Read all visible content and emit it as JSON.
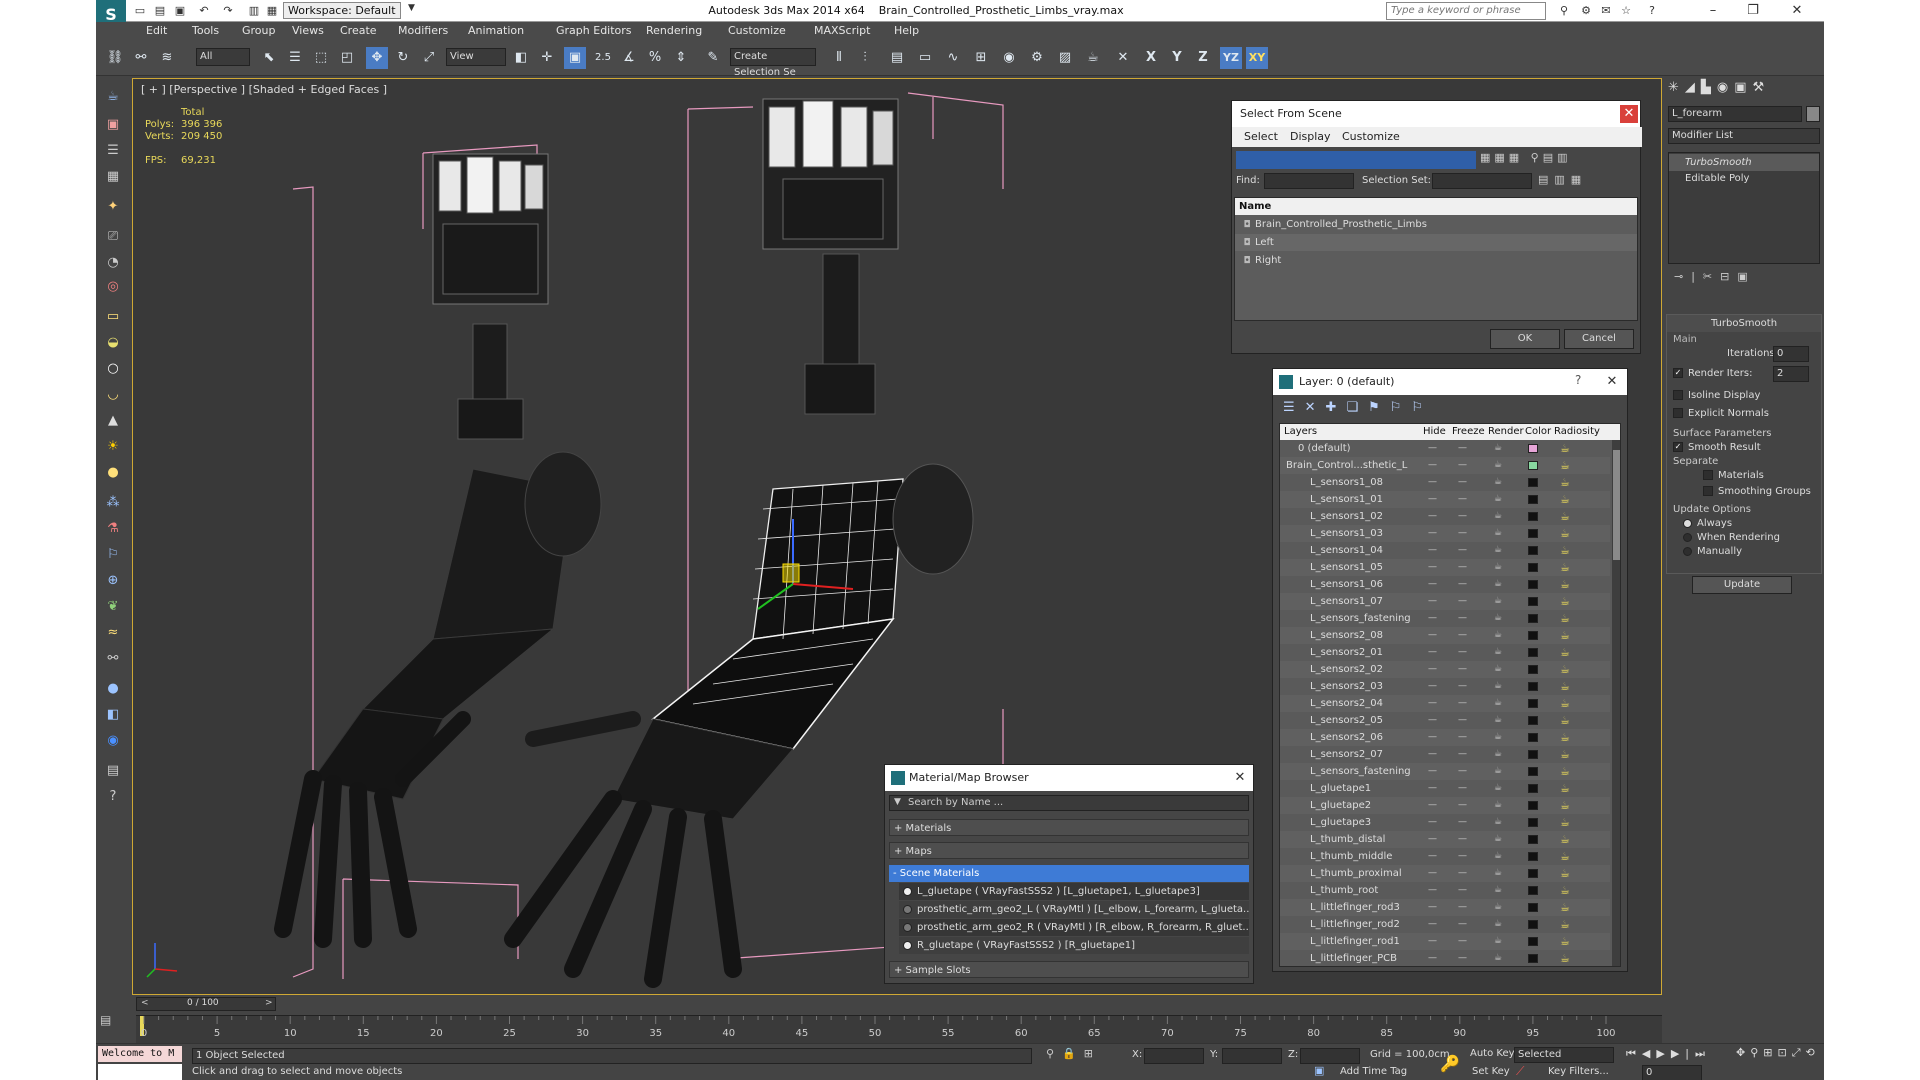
{
  "title_bar": {
    "workspace": "Workspace: Default",
    "app": "Autodesk 3ds Max  2014 x64",
    "file": "Brain_Controlled_Prosthetic_Limbs_vray.max",
    "search_placeholder": "Type a keyword or phrase"
  },
  "menu": [
    "Edit",
    "Tools",
    "Group",
    "Views",
    "Create",
    "Modifiers",
    "Animation",
    "Graph Editors",
    "Rendering",
    "Customize",
    "MAXScript",
    "Help"
  ],
  "toolbar": {
    "filter": "All",
    "refcoord": "View",
    "snap_label": "2.5",
    "selection_set": "Create Selection Se",
    "axis_x": "X",
    "axis_y": "Y",
    "axis_z": "Z",
    "axis_yz": "YZ",
    "axis_xy": "XY"
  },
  "viewport": {
    "label": "[ + ] [Perspective ] [Shaded + Edged Faces ]",
    "stats": {
      "total_label": "Total",
      "polys_label": "Polys:",
      "polys": "396 396",
      "verts_label": "Verts:",
      "verts": "209 450",
      "fps_label": "FPS:",
      "fps": "69,231"
    }
  },
  "select_from_scene": {
    "title": "Select From Scene",
    "menus": [
      "Select",
      "Display",
      "Customize"
    ],
    "find_label": "Find:",
    "selection_set_label": "Selection Set:",
    "column": "Name",
    "items": [
      "Brain_Controlled_Prosthetic_Limbs",
      "Left",
      "Right"
    ],
    "ok": "OK",
    "cancel": "Cancel"
  },
  "layer_dialog": {
    "title": "Layer: 0 (default)",
    "help": "?",
    "columns": [
      "Layers",
      "Hide",
      "Freeze",
      "Render",
      "Color",
      "Radiosity"
    ],
    "rows": [
      {
        "name": "0 (default)",
        "indent": 1,
        "color": "#e7a6d8"
      },
      {
        "name": "Brain_Control...sthetic_L",
        "indent": 0,
        "color": "#88d8a0"
      },
      {
        "name": "L_sensors1_08",
        "indent": 2,
        "color": "#111111"
      },
      {
        "name": "L_sensors1_01",
        "indent": 2,
        "color": "#111111"
      },
      {
        "name": "L_sensors1_02",
        "indent": 2,
        "color": "#111111"
      },
      {
        "name": "L_sensors1_03",
        "indent": 2,
        "color": "#111111"
      },
      {
        "name": "L_sensors1_04",
        "indent": 2,
        "color": "#111111"
      },
      {
        "name": "L_sensors1_05",
        "indent": 2,
        "color": "#111111"
      },
      {
        "name": "L_sensors1_06",
        "indent": 2,
        "color": "#111111"
      },
      {
        "name": "L_sensors1_07",
        "indent": 2,
        "color": "#111111"
      },
      {
        "name": "L_sensors_fastening",
        "indent": 2,
        "color": "#111111"
      },
      {
        "name": "L_sensors2_08",
        "indent": 2,
        "color": "#111111"
      },
      {
        "name": "L_sensors2_01",
        "indent": 2,
        "color": "#111111"
      },
      {
        "name": "L_sensors2_02",
        "indent": 2,
        "color": "#111111"
      },
      {
        "name": "L_sensors2_03",
        "indent": 2,
        "color": "#111111"
      },
      {
        "name": "L_sensors2_04",
        "indent": 2,
        "color": "#111111"
      },
      {
        "name": "L_sensors2_05",
        "indent": 2,
        "color": "#111111"
      },
      {
        "name": "L_sensors2_06",
        "indent": 2,
        "color": "#111111"
      },
      {
        "name": "L_sensors2_07",
        "indent": 2,
        "color": "#111111"
      },
      {
        "name": "L_sensors_fastening",
        "indent": 2,
        "color": "#111111"
      },
      {
        "name": "L_gluetape1",
        "indent": 2,
        "color": "#111111"
      },
      {
        "name": "L_gluetape2",
        "indent": 2,
        "color": "#111111"
      },
      {
        "name": "L_gluetape3",
        "indent": 2,
        "color": "#111111"
      },
      {
        "name": "L_thumb_distal",
        "indent": 2,
        "color": "#111111"
      },
      {
        "name": "L_thumb_middle",
        "indent": 2,
        "color": "#111111"
      },
      {
        "name": "L_thumb_proximal",
        "indent": 2,
        "color": "#111111"
      },
      {
        "name": "L_thumb_root",
        "indent": 2,
        "color": "#111111"
      },
      {
        "name": "L_littlefinger_rod3",
        "indent": 2,
        "color": "#111111"
      },
      {
        "name": "L_littlefinger_rod2",
        "indent": 2,
        "color": "#111111"
      },
      {
        "name": "L_littlefinger_rod1",
        "indent": 2,
        "color": "#111111"
      },
      {
        "name": "L_littlefinger_PCB",
        "indent": 2,
        "color": "#111111"
      }
    ]
  },
  "material_browser": {
    "title": "Material/Map Browser",
    "search_placeholder": "Search by Name ...",
    "groups": [
      "+ Materials",
      "+ Maps",
      "- Scene Materials"
    ],
    "materials": [
      "L_gluetape  ( VRayFastSSS2 )  [L_gluetape1, L_gluetape3]",
      "prosthetic_arm_geo2_L  ( VRayMtl )  [L_elbow, L_forearm, L_glueta...",
      "prosthetic_arm_geo2_R  ( VRayMtl )  [R_elbow, R_forearm, R_gluet...",
      "R_gluetape  ( VRayFastSSS2 )  [R_gluetape1]"
    ],
    "sample_slots": "+ Sample Slots"
  },
  "command_panel": {
    "object_name": "L_forearm",
    "modifier_list": "Modifier List",
    "stack": [
      "TurboSmooth",
      "Editable Poly"
    ],
    "rollout": "TurboSmooth",
    "main_label": "Main",
    "iterations_label": "Iterations:",
    "iterations": "0",
    "render_iters_label": "Render Iters:",
    "render_iters": "2",
    "isoline": "Isoline Display",
    "explicit": "Explicit Normals",
    "surface_params": "Surface Parameters",
    "smooth_result": "Smooth Result",
    "separate": "Separate",
    "materials": "Materials",
    "smoothing_groups": "Smoothing Groups",
    "update_options": "Update Options",
    "always": "Always",
    "when_rendering": "When Rendering",
    "manually": "Manually",
    "update": "Update"
  },
  "timeline": {
    "frame": "0 / 100",
    "ticks": [
      "0",
      "5",
      "10",
      "15",
      "20",
      "25",
      "30",
      "35",
      "40",
      "45",
      "50",
      "55",
      "60",
      "65",
      "70",
      "75",
      "80",
      "85",
      "90",
      "95",
      "100"
    ]
  },
  "status": {
    "maxscript": "Welcome to M",
    "selected": "1 Object Selected",
    "prompt": "Click and drag to select and move objects",
    "x_label": "X:",
    "y_label": "Y:",
    "z_label": "Z:",
    "grid": "Grid = 100,0cm",
    "add_time_tag": "Add Time Tag",
    "auto_key": "Auto Key",
    "set_key": "Set Key",
    "key_mode": "Selected",
    "key_filters": "Key Filters...",
    "frame_value": "0"
  }
}
